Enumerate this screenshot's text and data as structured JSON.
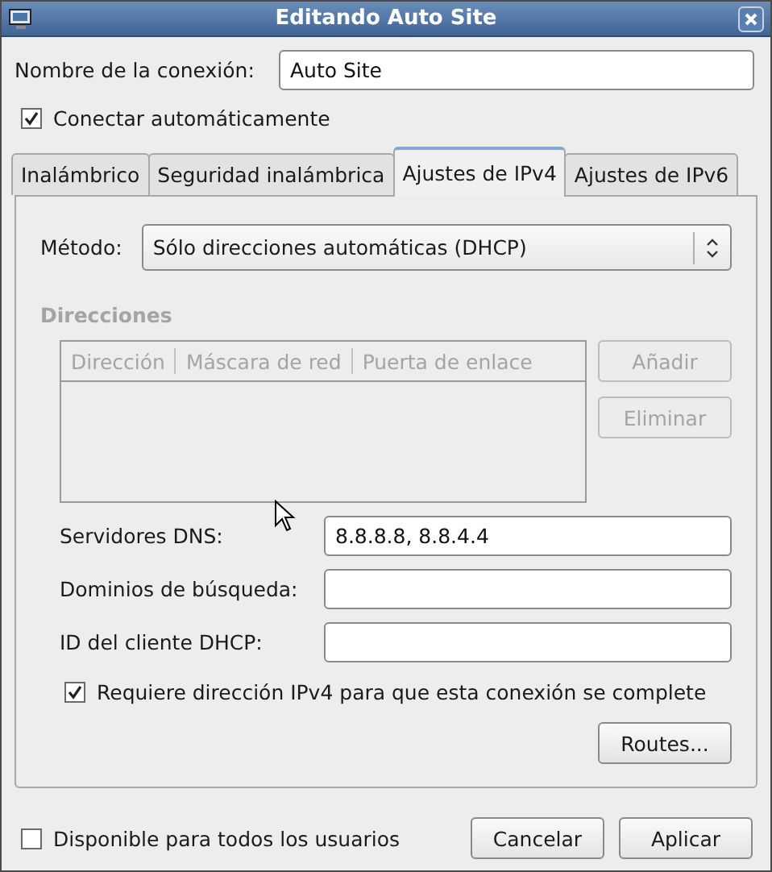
{
  "window": {
    "title": "Editando Auto Site"
  },
  "connection_name": {
    "label": "Nombre de la conexión:",
    "value": "Auto Site"
  },
  "auto_connect": {
    "label": "Conectar automáticamente",
    "checked": true
  },
  "tabs": [
    {
      "label": "Inalámbrico",
      "selected": false
    },
    {
      "label": "Seguridad inalámbrica",
      "selected": false
    },
    {
      "label": "Ajustes de IPv4",
      "selected": true
    },
    {
      "label": "Ajustes de IPv6",
      "selected": false
    }
  ],
  "ipv4": {
    "method": {
      "label": "Método:",
      "value": "Sólo direcciones automáticas (DHCP)"
    },
    "addresses": {
      "title": "Direcciones",
      "disabled": true,
      "columns": [
        "Dirección",
        "Máscara de red",
        "Puerta de enlace"
      ],
      "buttons": [
        {
          "label": "Añadir",
          "disabled": true
        },
        {
          "label": "Eliminar",
          "disabled": true
        }
      ]
    },
    "fields": [
      {
        "label": "Servidores DNS:",
        "value": "8.8.8.8, 8.8.4.4"
      },
      {
        "label": "Dominios de búsqueda:"
      },
      {
        "label": "ID del cliente DHCP:"
      }
    ],
    "require_ipv4": {
      "label": "Requiere dirección IPv4 para que esta conexión se complete",
      "checked": true
    },
    "routes_button": "Routes..."
  },
  "all_users": {
    "label": "Disponible para todos los usuarios",
    "checked": false
  },
  "buttons": [
    "Cancelar",
    "Aplicar"
  ]
}
